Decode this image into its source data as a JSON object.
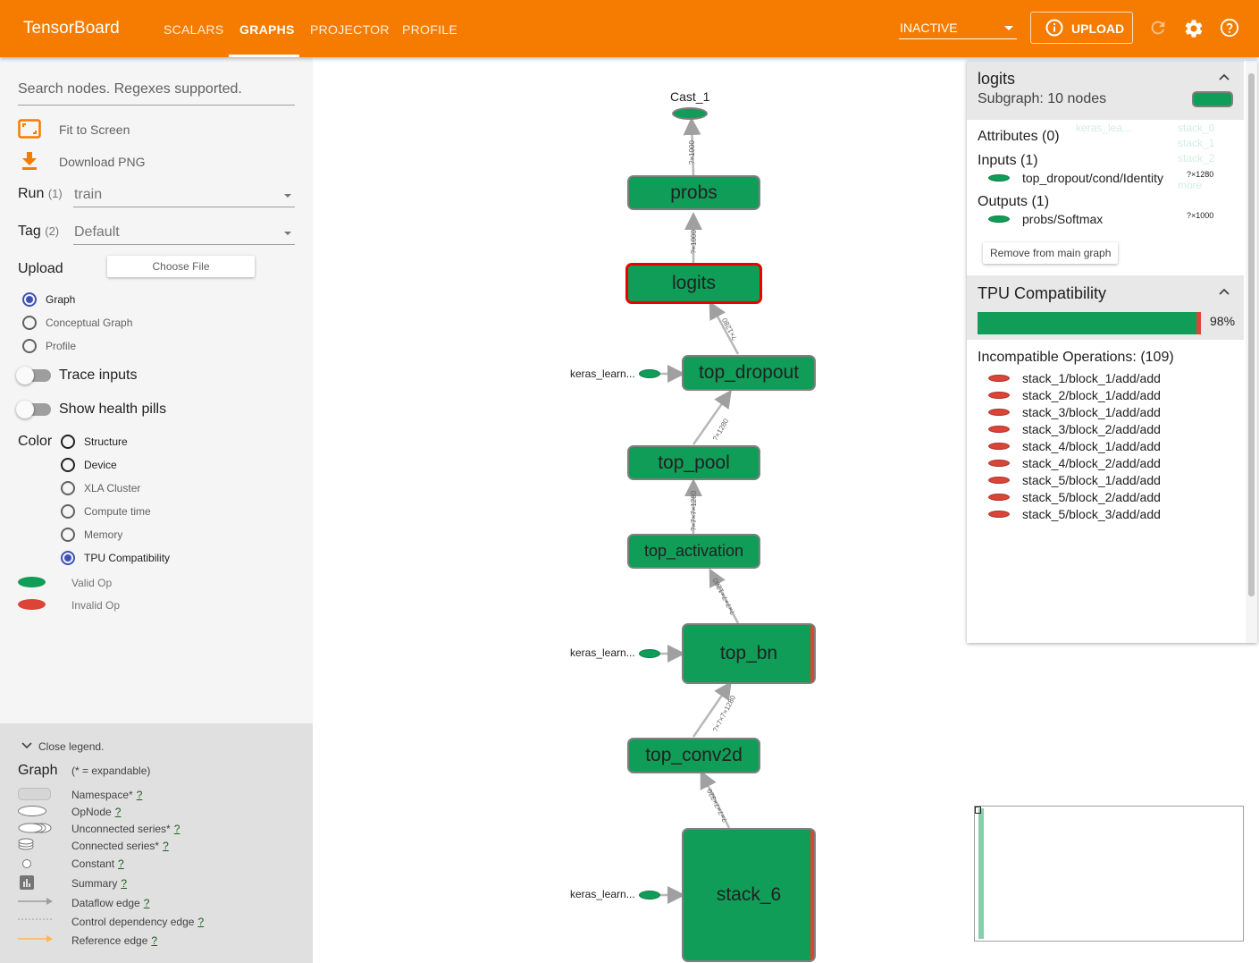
{
  "header": {
    "brand": "TensorBoard",
    "tabs": [
      "SCALARS",
      "GRAPHS",
      "PROJECTOR",
      "PROFILE"
    ],
    "active_tab": "GRAPHS",
    "status_select": "INACTIVE",
    "upload_label": "UPLOAD",
    "colors": {
      "bar": "#f57c00"
    }
  },
  "sidebar": {
    "search_placeholder": "Search nodes. Regexes supported.",
    "fit_label": "Fit to Screen",
    "download_label": "Download PNG",
    "run_label": "Run",
    "run_count": "(1)",
    "run_value": "train",
    "tag_label": "Tag",
    "tag_count": "(2)",
    "tag_value": "Default",
    "upload_label": "Upload",
    "choose_file": "Choose File",
    "graph_types": [
      "Graph",
      "Conceptual Graph",
      "Profile"
    ],
    "graph_type_selected": "Graph",
    "trace_inputs": "Trace inputs",
    "health_pills": "Show health pills",
    "color_label": "Color",
    "color_options": [
      "Structure",
      "Device",
      "XLA Cluster",
      "Compute time",
      "Memory",
      "TPU Compatibility"
    ],
    "color_selected": "TPU Compatibility",
    "valid_op": "Valid Op",
    "invalid_op": "Invalid Op"
  },
  "legend": {
    "close": "Close legend.",
    "title": "Graph",
    "note": "(* = expandable)",
    "items": [
      {
        "label": "Namespace*",
        "q": "?"
      },
      {
        "label": "OpNode",
        "q": "?"
      },
      {
        "label": "Unconnected series*",
        "q": "?"
      },
      {
        "label": "Connected series*",
        "q": "?"
      },
      {
        "label": "Constant",
        "q": "?"
      },
      {
        "label": "Summary",
        "q": "?"
      },
      {
        "label": "Dataflow edge",
        "q": "?"
      },
      {
        "label": "Control dependency edge",
        "q": "?"
      },
      {
        "label": "Reference edge",
        "q": "?"
      }
    ]
  },
  "graph": {
    "nodes": {
      "cast": "Cast_1",
      "probs": "probs",
      "logits": "logits",
      "top_dropout": "top_dropout",
      "top_pool": "top_pool",
      "top_activation": "top_activation",
      "top_bn": "top_bn",
      "top_conv2d": "top_conv2d",
      "stack_6": "stack_6"
    },
    "side_inputs": [
      "keras_learn...",
      "keras_learn...",
      "keras_learn..."
    ],
    "edge_labels": [
      "?×1000",
      "?×1000",
      "?×1280",
      "?×1280",
      "?×7×7×1280",
      "?×7×7×1280",
      "?×7×7×1280",
      "?×7×7×320"
    ]
  },
  "info": {
    "title": "logits",
    "subtitle": "Subgraph: 10 nodes",
    "attributes": "Attributes (0)",
    "inputs": "Inputs (1)",
    "input_name": "top_dropout/cond/Identity",
    "input_shape": "?×1280",
    "outputs": "Outputs (1)",
    "output_name": "probs/Softmax",
    "output_shape": "?×1000",
    "remove": "Remove from main graph",
    "tpu_title": "TPU Compatibility",
    "tpu_percent": "98%",
    "tpu_fraction": 0.98,
    "incompat_title": "Incompatible Operations: (109)",
    "incompat_ops": [
      "stack_1/block_1/add/add",
      "stack_2/block_1/add/add",
      "stack_3/block_1/add/add",
      "stack_3/block_2/add/add",
      "stack_4/block_1/add/add",
      "stack_4/block_2/add/add",
      "stack_5/block_1/add/add",
      "stack_5/block_2/add/add",
      "stack_5/block_3/add/add"
    ],
    "ghost_labels": [
      "keras_lea...",
      "stack_0",
      "stack_1",
      "stack_2",
      "more"
    ]
  },
  "colors": {
    "valid": "#0f9d58",
    "invalid": "#db4437",
    "accent": "#3f51b5"
  }
}
